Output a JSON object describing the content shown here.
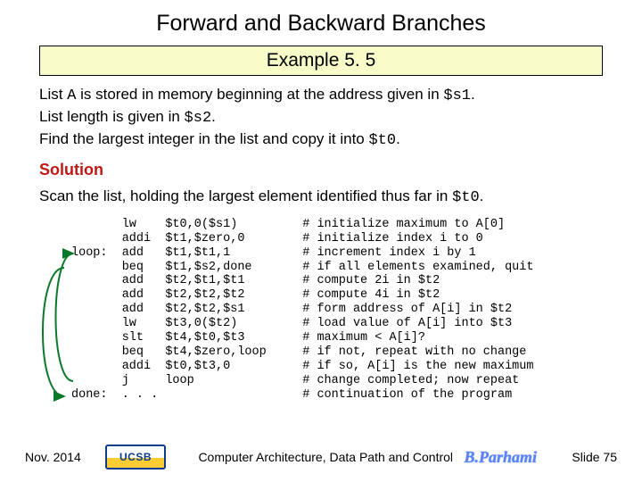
{
  "title": "Forward and Backward Branches",
  "example_label": "Example 5. 5",
  "problem_html": "List <code>A</code> is stored in memory beginning at the address given in <code>$s1</code>.\nList length is given in <code>$s2</code>.\nFind the largest integer in the list and copy it into <code>$t0</code>.",
  "problem_lines": {
    "l1a": "List ",
    "l1code1": "A",
    "l1b": " is stored in memory beginning at the address given in ",
    "l1code2": "$s1",
    "l1c": ".",
    "l2a": "List length is given in ",
    "l2code": "$s2",
    "l2b": ".",
    "l3a": "Find the largest integer in the list and copy it into ",
    "l3code": "$t0",
    "l3b": "."
  },
  "solution_label": "Solution",
  "scan_line": {
    "a": "Scan the list, holding the largest element identified thus far in ",
    "code": "$t0",
    "b": "."
  },
  "code": {
    "labels": [
      "",
      "",
      "loop:",
      "",
      "",
      "",
      "",
      "",
      "",
      "",
      "",
      "",
      "done:"
    ],
    "ops": [
      "lw",
      "addi",
      "add",
      "beq",
      "add",
      "add",
      "add",
      "lw",
      "slt",
      "beq",
      "addi",
      "j",
      ". . ."
    ],
    "args": [
      "$t0,0($s1)",
      "$t1,$zero,0",
      "$t1,$t1,1",
      "$t1,$s2,done",
      "$t2,$t1,$t1",
      "$t2,$t2,$t2",
      "$t2,$t2,$s1",
      "$t3,0($t2)",
      "$t4,$t0,$t3",
      "$t4,$zero,loop",
      "$t0,$t3,0",
      "loop",
      ""
    ],
    "comments": [
      "initialize maximum to A[0]",
      "initialize index i to 0",
      "increment index i by 1",
      "if all elements examined, quit",
      "compute 2i in $t2",
      "compute 4i in $t2",
      "form address of A[i] in $t2",
      "load value of A[i] into $t3",
      "maximum < A[i]?",
      "if not, repeat with no change",
      "if so, A[i] is the new maximum",
      "change completed; now repeat",
      "continuation of the program"
    ]
  },
  "footer": {
    "date": "Nov. 2014",
    "logo": "UCSB",
    "mid": "Computer Architecture, Data Path and Control",
    "author": "B.Parhami",
    "slide": "Slide 75"
  }
}
